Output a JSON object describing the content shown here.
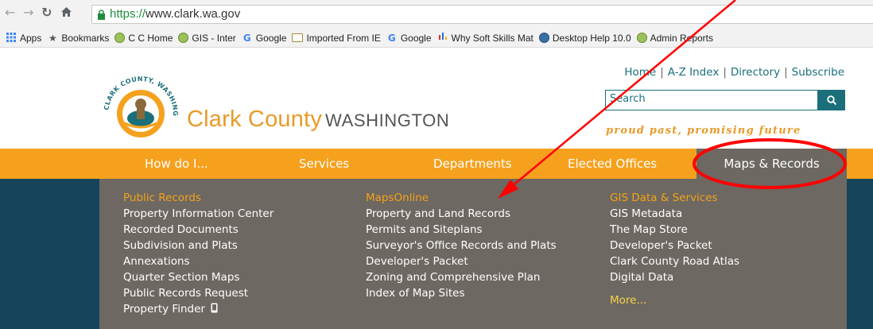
{
  "browser": {
    "url_scheme": "https://",
    "url_rest": "www.clark.wa.gov",
    "bookmarks": [
      {
        "label": "Apps",
        "icon": "apps-grid-icon"
      },
      {
        "label": "Bookmarks",
        "icon": "star-icon"
      },
      {
        "label": "C C Home",
        "icon": "globe-icon"
      },
      {
        "label": "GIS - Inter",
        "icon": "globe-icon"
      },
      {
        "label": "Google",
        "icon": "google-icon"
      },
      {
        "label": "Imported From IE",
        "icon": "folder-icon"
      },
      {
        "label": "Google",
        "icon": "google-icon"
      },
      {
        "label": "Why Soft Skills Mat",
        "icon": "bars-icon"
      },
      {
        "label": "Desktop Help 10.0",
        "icon": "esri-globe-icon"
      },
      {
        "label": "Admin Reports",
        "icon": "globe-icon"
      }
    ]
  },
  "header": {
    "brand_main": "Clark County",
    "brand_state": "WASHINGTON",
    "seal_text": "CLARK COUNTY, WASHINGTON",
    "utility_links": [
      "Home",
      "A-Z Index",
      "Directory",
      "Subscribe"
    ],
    "search_placeholder": "Search",
    "tagline": "proud past, promising future"
  },
  "nav": {
    "items": [
      "How do I...",
      "Services",
      "Departments",
      "Elected Offices",
      "Maps & Records"
    ],
    "active_index": 4
  },
  "dropdown": {
    "col1": {
      "heading": "Public Records",
      "links": [
        "Property Information Center",
        "Recorded Documents",
        "Subdivision and Plats",
        "Annexations",
        "Quarter Section Maps",
        "Public Records Request",
        "Property Finder"
      ]
    },
    "col2": {
      "heading": "MapsOnline",
      "links": [
        "Property and Land Records",
        "Permits and Siteplans",
        "Surveyor's Office Records and Plats",
        "Developer's Packet",
        "Zoning and Comprehensive Plan",
        "Index of Map Sites"
      ]
    },
    "col3": {
      "heading": "GIS Data & Services",
      "links": [
        "GIS Metadata",
        "The Map Store",
        "Developer's Packet",
        "Clark County Road Atlas",
        "Digital Data"
      ],
      "more": "More..."
    }
  },
  "colors": {
    "nav_orange": "#f5a11d",
    "dropdown_gray": "#6d6861",
    "page_teal": "#16445a",
    "brand_orange": "#e89a2a",
    "link_teal": "#1a6f7a",
    "annotation_red": "#ff0000"
  }
}
